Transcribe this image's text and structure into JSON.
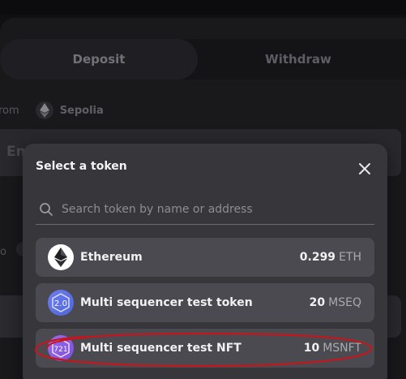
{
  "tabs": [
    {
      "label": "Deposit",
      "active": true
    },
    {
      "label": "Withdraw",
      "active": false
    }
  ],
  "from": {
    "label": "rom",
    "network": "Sepolia",
    "network_icon": "ethereum-icon"
  },
  "amount_field": {
    "placeholder_visible": "En"
  },
  "left_stub": {
    "text": "o"
  },
  "modal": {
    "title": "Select a token",
    "close_icon": "close-icon",
    "search": {
      "placeholder": "Search token by name or address",
      "value": ""
    },
    "tokens": [
      {
        "name": "Ethereum",
        "amount": "0.299",
        "symbol": "ETH",
        "icon": "ethereum-icon",
        "icon_text": ""
      },
      {
        "name": "Multi sequencer test token",
        "amount": "20",
        "symbol": "MSEQ",
        "icon": "erc20-icon",
        "icon_text": "2.0"
      },
      {
        "name": "Multi sequencer test NFT",
        "amount": "10",
        "symbol": "MSNFT",
        "icon": "nft-icon",
        "icon_text": "721",
        "highlighted": true
      }
    ]
  },
  "colors": {
    "modal_bg": "#36363b",
    "row_bg": "#4a4a50",
    "highlight": "#c4161c",
    "accent": "#7b4fd6"
  }
}
